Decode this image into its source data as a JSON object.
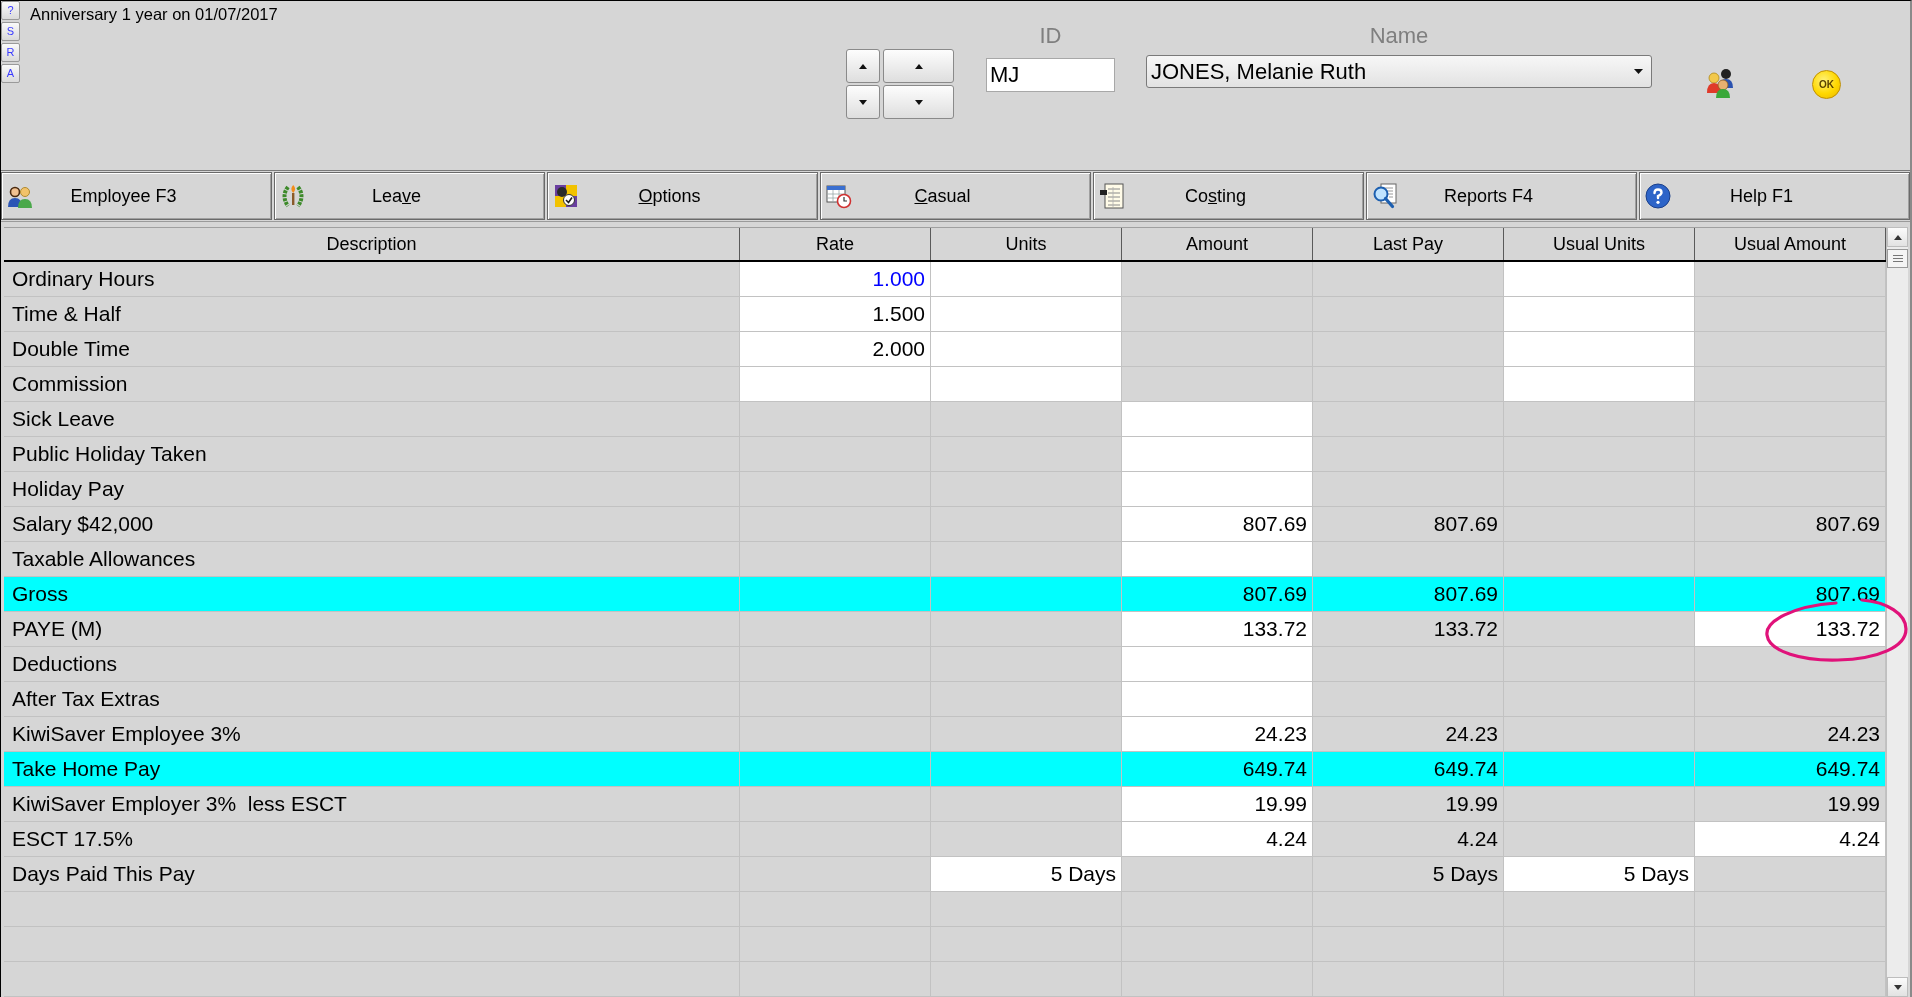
{
  "side_buttons": [
    {
      "label": "?"
    },
    {
      "label": "S"
    },
    {
      "label": "R"
    },
    {
      "label": "A"
    }
  ],
  "notice": "Anniversary 1 year on 01/07/2017",
  "employee_selector": {
    "id_label": "ID",
    "id_value": "MJ",
    "name_label": "Name",
    "name_value": "JONES, Melanie Ruth"
  },
  "ok_button": {
    "label": "OK"
  },
  "toolbar": [
    {
      "label_parts": [
        {
          "text": "Employee F3",
          "underlined": false
        }
      ]
    },
    {
      "label_parts": [
        {
          "text": "Lea",
          "underlined": false
        },
        {
          "text": "v",
          "underlined": true
        },
        {
          "text": "e",
          "underlined": false
        }
      ]
    },
    {
      "label_parts": [
        {
          "text": "O",
          "underlined": true
        },
        {
          "text": "ptions",
          "underlined": false
        }
      ]
    },
    {
      "label_parts": [
        {
          "text": "C",
          "underlined": true
        },
        {
          "text": "asual",
          "underlined": false
        }
      ]
    },
    {
      "label_parts": [
        {
          "text": "Co",
          "underlined": false
        },
        {
          "text": "s",
          "underlined": true
        },
        {
          "text": "ting",
          "underlined": false
        }
      ]
    },
    {
      "label_parts": [
        {
          "text": "Reports F4",
          "underlined": false
        }
      ]
    },
    {
      "label_parts": [
        {
          "text": "Help F1",
          "underlined": false
        }
      ]
    }
  ],
  "table": {
    "columns": [
      "Description",
      "Rate",
      "Units",
      "Amount",
      "Last Pay",
      "Usual Units",
      "Usual Amount"
    ],
    "rows": [
      {
        "description": "Ordinary Hours",
        "highlighted": false,
        "cells": [
          {
            "text": "1.000",
            "editable": true,
            "color": "#0000ff"
          },
          {
            "editable": true
          },
          {
            "editable": false
          },
          {
            "editable": false
          },
          {
            "editable": true
          },
          {
            "editable": false
          }
        ]
      },
      {
        "description": "Time & Half",
        "highlighted": false,
        "cells": [
          {
            "text": "1.500",
            "editable": true
          },
          {
            "editable": true
          },
          {
            "editable": false
          },
          {
            "editable": false
          },
          {
            "editable": true
          },
          {
            "editable": false
          }
        ]
      },
      {
        "description": "Double Time",
        "highlighted": false,
        "cells": [
          {
            "text": "2.000",
            "editable": true
          },
          {
            "editable": true
          },
          {
            "editable": false
          },
          {
            "editable": false
          },
          {
            "editable": true
          },
          {
            "editable": false
          }
        ]
      },
      {
        "description": "Commission",
        "highlighted": false,
        "cells": [
          {
            "editable": true
          },
          {
            "editable": true
          },
          {
            "editable": false
          },
          {
            "editable": false
          },
          {
            "editable": true
          },
          {
            "editable": false
          }
        ]
      },
      {
        "description": "Sick Leave",
        "highlighted": false,
        "cells": [
          {
            "editable": false
          },
          {
            "editable": false
          },
          {
            "editable": true
          },
          {
            "editable": false
          },
          {
            "editable": false
          },
          {
            "editable": false
          }
        ]
      },
      {
        "description": "Public Holiday Taken",
        "highlighted": false,
        "cells": [
          {
            "editable": false
          },
          {
            "editable": false
          },
          {
            "editable": true
          },
          {
            "editable": false
          },
          {
            "editable": false
          },
          {
            "editable": false
          }
        ]
      },
      {
        "description": "Holiday Pay",
        "highlighted": false,
        "cells": [
          {
            "editable": false
          },
          {
            "editable": false
          },
          {
            "editable": true
          },
          {
            "editable": false
          },
          {
            "editable": false
          },
          {
            "editable": false
          }
        ]
      },
      {
        "description": "Salary $42,000",
        "highlighted": false,
        "cells": [
          {
            "editable": false
          },
          {
            "editable": false
          },
          {
            "text": "807.69",
            "editable": true
          },
          {
            "text": "807.69",
            "editable": false
          },
          {
            "editable": false
          },
          {
            "text": "807.69",
            "editable": false
          }
        ]
      },
      {
        "description": "Taxable Allowances",
        "highlighted": false,
        "cells": [
          {
            "editable": false
          },
          {
            "editable": false
          },
          {
            "editable": true
          },
          {
            "editable": false
          },
          {
            "editable": false
          },
          {
            "editable": false
          }
        ]
      },
      {
        "description": "Gross",
        "highlighted": true,
        "cells": [
          {
            "editable": false
          },
          {
            "editable": false
          },
          {
            "text": "807.69",
            "editable": false
          },
          {
            "text": "807.69",
            "editable": false
          },
          {
            "editable": false
          },
          {
            "text": "807.69",
            "editable": false
          }
        ]
      },
      {
        "description": "PAYE (M)",
        "highlighted": false,
        "cells": [
          {
            "editable": false
          },
          {
            "editable": false
          },
          {
            "text": "133.72",
            "editable": true
          },
          {
            "text": "133.72",
            "editable": false
          },
          {
            "editable": false
          },
          {
            "text": "133.72",
            "editable": true,
            "circled": true
          }
        ]
      },
      {
        "description": "Deductions",
        "highlighted": false,
        "cells": [
          {
            "editable": false
          },
          {
            "editable": false
          },
          {
            "editable": true
          },
          {
            "editable": false
          },
          {
            "editable": false
          },
          {
            "editable": false
          }
        ]
      },
      {
        "description": "After Tax Extras",
        "highlighted": false,
        "cells": [
          {
            "editable": false
          },
          {
            "editable": false
          },
          {
            "editable": true
          },
          {
            "editable": false
          },
          {
            "editable": false
          },
          {
            "editable": false
          }
        ]
      },
      {
        "description": "KiwiSaver Employee 3%",
        "highlighted": false,
        "cells": [
          {
            "editable": false
          },
          {
            "editable": false
          },
          {
            "text": "24.23",
            "editable": true
          },
          {
            "text": "24.23",
            "editable": false
          },
          {
            "editable": false
          },
          {
            "text": "24.23",
            "editable": false
          }
        ]
      },
      {
        "description": "Take Home Pay",
        "highlighted": true,
        "cells": [
          {
            "editable": false
          },
          {
            "editable": false
          },
          {
            "text": "649.74",
            "editable": false
          },
          {
            "text": "649.74",
            "editable": false
          },
          {
            "editable": false
          },
          {
            "text": "649.74",
            "editable": false
          }
        ]
      },
      {
        "description": "KiwiSaver Employer 3%  less ESCT",
        "highlighted": false,
        "cells": [
          {
            "editable": false
          },
          {
            "editable": false
          },
          {
            "text": "19.99",
            "editable": true
          },
          {
            "text": "19.99",
            "editable": false
          },
          {
            "editable": false
          },
          {
            "text": "19.99",
            "editable": false
          }
        ]
      },
      {
        "description": "ESCT 17.5%",
        "highlighted": false,
        "cells": [
          {
            "editable": false
          },
          {
            "editable": false
          },
          {
            "text": "4.24",
            "editable": true
          },
          {
            "text": "4.24",
            "editable": false
          },
          {
            "editable": false
          },
          {
            "text": "4.24",
            "editable": true
          }
        ]
      },
      {
        "description": "Days Paid This Pay",
        "highlighted": false,
        "cells": [
          {
            "editable": false
          },
          {
            "text": "5 Days",
            "editable": true
          },
          {
            "editable": false
          },
          {
            "text": "5 Days",
            "editable": false
          },
          {
            "text": "5 Days",
            "editable": true
          },
          {
            "editable": false
          }
        ]
      }
    ]
  }
}
